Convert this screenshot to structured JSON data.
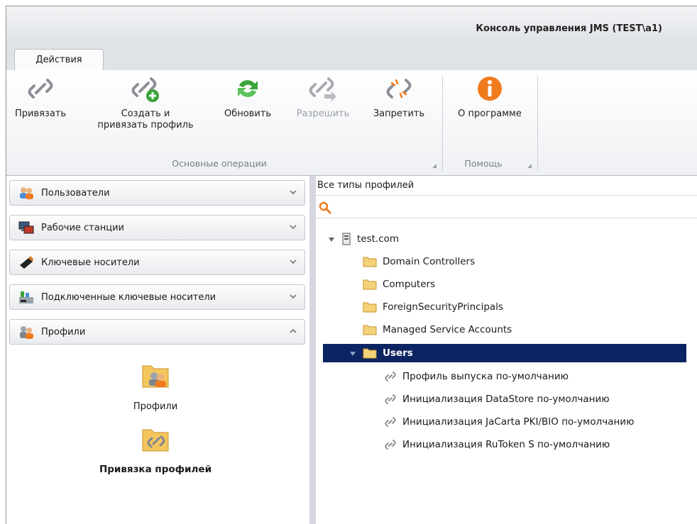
{
  "window": {
    "title": "Консоль управления JMS (TEST\\a1)"
  },
  "ribbon": {
    "tab_label": "Действия",
    "buttons": {
      "bind": "Привязать",
      "create_bind_1": "Создать и",
      "create_bind_2": "привязать профиль",
      "refresh": "Обновить",
      "allow": "Разрешить",
      "deny": "Запретить",
      "about": "О программе"
    },
    "groups": {
      "main": "Основные операции",
      "help": "Помощь"
    }
  },
  "nav": {
    "items": [
      {
        "label": "Пользователи",
        "icon": "users-icon"
      },
      {
        "label": "Рабочие станции",
        "icon": "workstations-icon"
      },
      {
        "label": "Ключевые носители",
        "icon": "usb-token-icon"
      },
      {
        "label": "Подключенные ключевые носители",
        "icon": "connected-tokens-icon"
      },
      {
        "label": "Профили",
        "icon": "profiles-icon"
      }
    ],
    "profiles_section": {
      "items": [
        {
          "label": "Профили",
          "icon": "profiles-folder-icon"
        },
        {
          "label": "Привязка профилей",
          "icon": "profile-binding-folder-icon"
        }
      ]
    }
  },
  "main": {
    "filter_value": "Все типы профилей",
    "tree": {
      "root": "test.com",
      "folders": [
        "Domain Controllers",
        "Computers",
        "ForeignSecurityPrincipals",
        "Managed Service Accounts"
      ],
      "selected": "Users",
      "profiles": [
        "Профиль выпуска по-умолчанию",
        "Инициализация DataStore по-умолчанию",
        "Инициализация JaCarta PKI/BIO по-умолчанию",
        "Инициализация RuToken S по-умолчанию"
      ]
    }
  },
  "colors": {
    "selection": "#0c2461",
    "accent_orange": "#f07b1d",
    "refresh_green": "#3aa33a"
  }
}
